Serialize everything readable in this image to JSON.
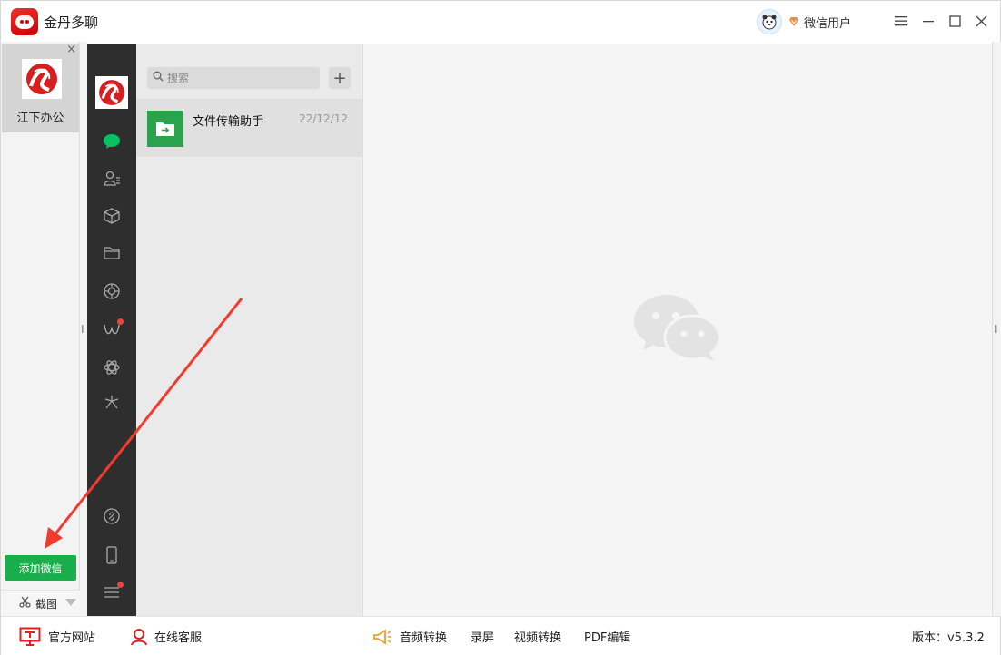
{
  "app": {
    "title": "金丹多聊",
    "user_name": "微信用户",
    "brand_color": "#e02020"
  },
  "window_controls": {
    "menu_icon": "hamburger-icon",
    "minimize_icon": "minimize-icon",
    "maximize_icon": "maximize-icon",
    "close_icon": "close-icon"
  },
  "accounts": {
    "items": [
      {
        "name": "江下办公",
        "close": "×"
      }
    ],
    "add_button": "添加微信",
    "add_button_color": "#1aad4b",
    "screenshot_tool": "截图"
  },
  "wechat": {
    "nav_icons": [
      "chat-icon",
      "contacts-icon",
      "favorites-icon",
      "files-icon",
      "moments-icon",
      "channels-icon",
      "search-icon",
      "mini-programs-icon",
      "link-icon",
      "phone-icon",
      "menu-icon"
    ],
    "search": {
      "placeholder": "搜索",
      "add": "+"
    },
    "chats": [
      {
        "name": "文件传输助手",
        "time": "22/12/12"
      }
    ]
  },
  "bottombar": {
    "official_site": "官方网站",
    "online_service": "在线客服",
    "audio_convert": "音频转换",
    "screen_record": "录屏",
    "video_convert": "视频转换",
    "pdf_edit": "PDF编辑",
    "version": "版本：v5.3.2"
  }
}
